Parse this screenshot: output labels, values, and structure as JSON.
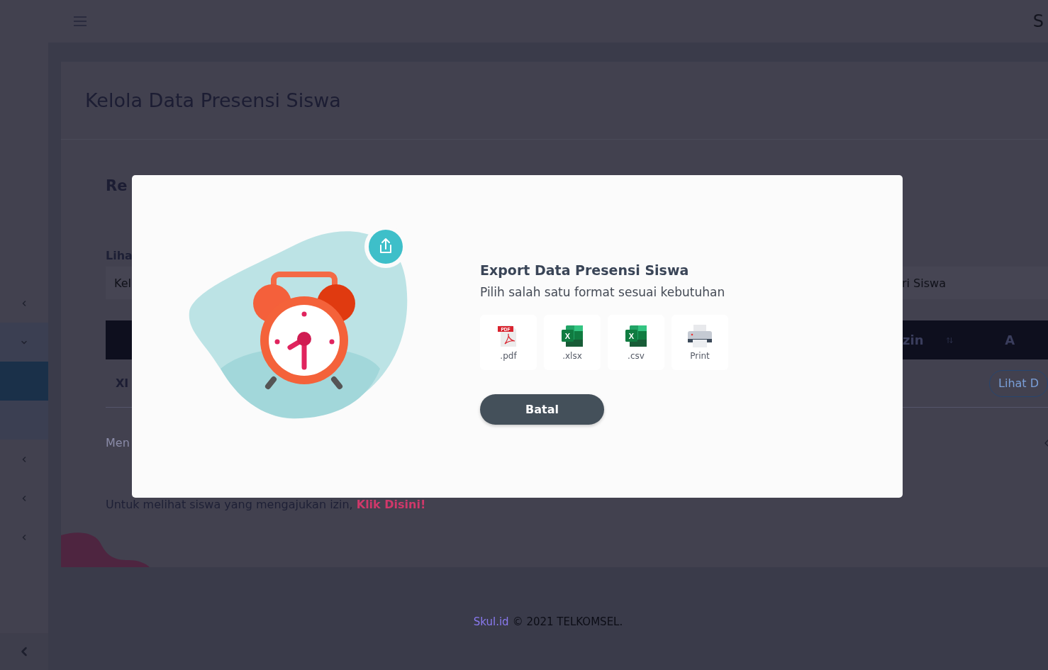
{
  "topbar": {
    "brand_partial": "S"
  },
  "sidebar": {
    "items": [
      {
        "expanded": false
      },
      {
        "expanded": true,
        "children": [
          {
            "selected": true
          },
          {
            "selected": false
          }
        ]
      },
      {
        "expanded": false
      },
      {
        "expanded": false
      },
      {
        "expanded": false
      }
    ]
  },
  "page": {
    "title": "Kelola Data Presensi Siswa",
    "section_title": "Re",
    "filter_label": "Liha",
    "class_field_placeholder": "Kel",
    "search_placeholder": "ri Siswa",
    "table": {
      "columns": [
        "zin",
        "A"
      ],
      "rows": [
        {
          "class": "XI",
          "action": "Lihat D"
        }
      ]
    },
    "pagination_info": "Men",
    "note": "Untuk melihat siswa yang mengajukan izin,",
    "note_link": "Klik Disini!"
  },
  "footer": {
    "brand": "Skul.id",
    "copyright": "© 2021 TELKOMSEL."
  },
  "modal": {
    "title": "Export Data Presensi Siswa",
    "subtitle": "Pilih salah satu format sesuai kebutuhan",
    "formats": [
      {
        "kind": "pdf",
        "label": ".pdf",
        "icon_text": "PDF"
      },
      {
        "kind": "excel",
        "label": ".xlsx",
        "icon_text": "X"
      },
      {
        "kind": "excel",
        "label": ".csv",
        "icon_text": "X"
      },
      {
        "kind": "print",
        "label": "Print"
      }
    ],
    "cancel": "Batal"
  }
}
